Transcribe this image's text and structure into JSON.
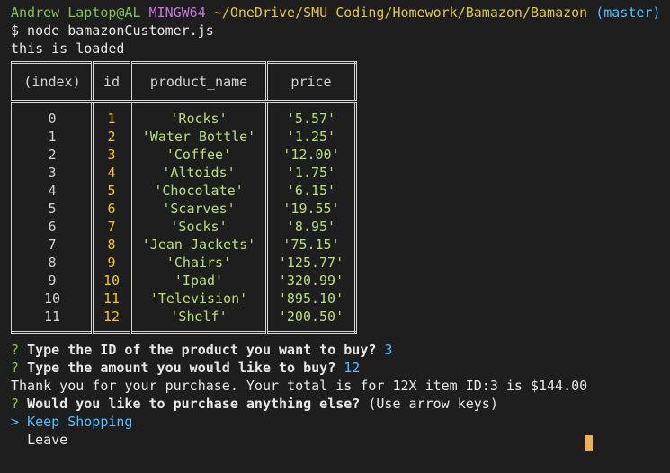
{
  "prompt": {
    "user_host": "Andrew Laptop@AL",
    "shell": "MINGW64",
    "path": "~/OneDrive/SMU Coding/Homework/Bamazon/Bamazon",
    "branch": "(master)"
  },
  "command": "$ node bamazonCustomer.js",
  "loaded_msg": "this is loaded",
  "table": {
    "headers": [
      "(index)",
      "id",
      "product_name",
      "price"
    ],
    "rows": [
      {
        "index": "0",
        "id": "1",
        "name": "'Rocks'",
        "price": "'5.57'"
      },
      {
        "index": "1",
        "id": "2",
        "name": "'Water Bottle'",
        "price": "'1.25'"
      },
      {
        "index": "2",
        "id": "3",
        "name": "'Coffee'",
        "price": "'12.00'"
      },
      {
        "index": "3",
        "id": "4",
        "name": "'Altoids'",
        "price": "'1.75'"
      },
      {
        "index": "4",
        "id": "5",
        "name": "'Chocolate'",
        "price": "'6.15'"
      },
      {
        "index": "5",
        "id": "6",
        "name": "'Scarves'",
        "price": "'19.55'"
      },
      {
        "index": "6",
        "id": "7",
        "name": "'Socks'",
        "price": "'8.95'"
      },
      {
        "index": "7",
        "id": "8",
        "name": "'Jean Jackets'",
        "price": "'75.15'"
      },
      {
        "index": "8",
        "id": "9",
        "name": "'Chairs'",
        "price": "'125.77'"
      },
      {
        "index": "9",
        "id": "10",
        "name": "'Ipad'",
        "price": "'320.99'"
      },
      {
        "index": "10",
        "id": "11",
        "name": "'Television'",
        "price": "'895.10'"
      },
      {
        "index": "11",
        "id": "12",
        "name": "'Shelf'",
        "price": "'200.50'"
      }
    ]
  },
  "q1": {
    "mark": "?",
    "text": "Type the ID of the product you want to buy?",
    "answer": "3"
  },
  "q2": {
    "mark": "?",
    "text": "Type the amount you would like to buy?",
    "answer": "12"
  },
  "thanks": "Thank you for your purchase. Your total is for 12X item ID:3 is $144.00",
  "q3": {
    "mark": "?",
    "text": "Would you like to purchase anything else?",
    "hint": "(Use arrow keys)"
  },
  "choices": {
    "pointer": ">",
    "keep": "Keep Shopping",
    "leave": "Leave"
  }
}
